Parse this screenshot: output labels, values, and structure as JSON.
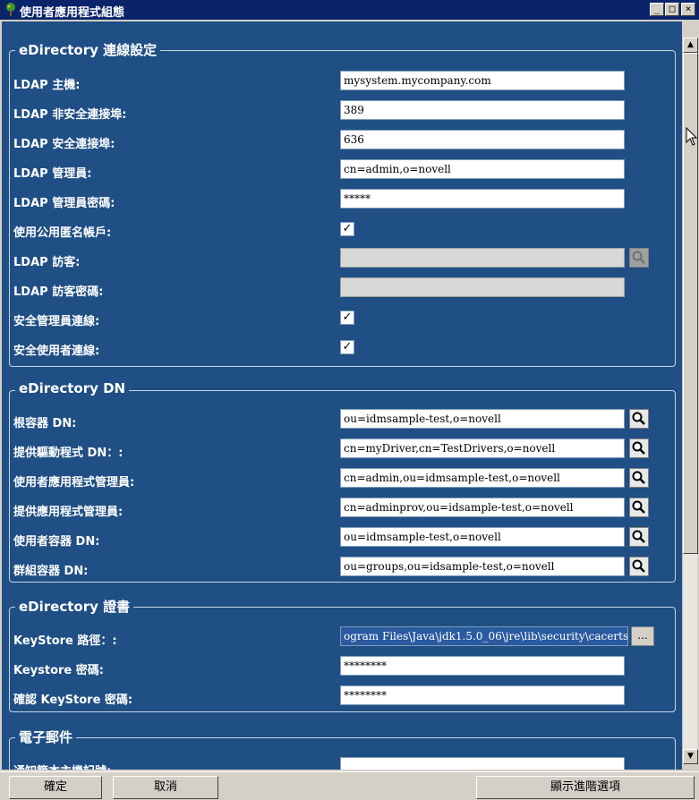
{
  "window": {
    "title": "使用者應用程式組態",
    "minimize": "_",
    "maximize": "□",
    "close": "×"
  },
  "sections": {
    "connection": {
      "title": "eDirectory 連線設定",
      "rows": [
        {
          "label": "LDAP 主機:",
          "value": "mysystem.mycompany.com"
        },
        {
          "label": "LDAP 非安全連接埠:",
          "value": "389"
        },
        {
          "label": "LDAP 安全連接埠:",
          "value": "636"
        },
        {
          "label": "LDAP 管理員:",
          "value": "cn=admin,o=novell"
        },
        {
          "label": "LDAP 管理員密碼:",
          "value": "*****"
        },
        {
          "label": "使用公用匿名帳戶:",
          "checked": true
        },
        {
          "label": "LDAP 訪客:",
          "value": ""
        },
        {
          "label": "LDAP 訪客密碼:",
          "value": ""
        },
        {
          "label": "安全管理員連線:",
          "checked": true
        },
        {
          "label": "安全使用者連線:",
          "checked": true
        }
      ]
    },
    "dn": {
      "title": "eDirectory DN",
      "rows": [
        {
          "label": "根容器 DN:",
          "value": "ou=idmsample-test,o=novell"
        },
        {
          "label": "提供驅動程式 DN：:",
          "value": "cn=myDriver,cn=TestDrivers,o=novell"
        },
        {
          "label": "使用者應用程式管理員:",
          "value": "cn=admin,ou=idmsample-test,o=novell"
        },
        {
          "label": "提供應用程式管理員:",
          "value": "cn=adminprov,ou=idsample-test,o=novell"
        },
        {
          "label": "使用者容器 DN:",
          "value": "ou=idmsample-test,o=novell"
        },
        {
          "label": "群組容器 DN:",
          "value": "ou=groups,ou=idsample-test,o=novell"
        }
      ]
    },
    "cert": {
      "title": "eDirectory 證書",
      "rows": [
        {
          "label": "KeyStore 路徑：:",
          "value": "ogram Files\\Java\\jdk1.5.0_06\\jre\\lib\\security\\cacerts",
          "browse": "..."
        },
        {
          "label": "Keystore 密碼:",
          "value": "********"
        },
        {
          "label": "確認 KeyStore 密碼:",
          "value": "********"
        }
      ]
    },
    "email": {
      "title": "電子郵件",
      "rows": [
        {
          "label": "通知範本主機記號:",
          "value": ""
        }
      ]
    }
  },
  "buttons": {
    "ok": "確定",
    "cancel": "取消",
    "advanced": "顯示進階選項"
  },
  "colors": {
    "panel_bg": "#1f4f84",
    "titlebar_bg": "#0a246a",
    "chrome": "#d4d0c8"
  }
}
